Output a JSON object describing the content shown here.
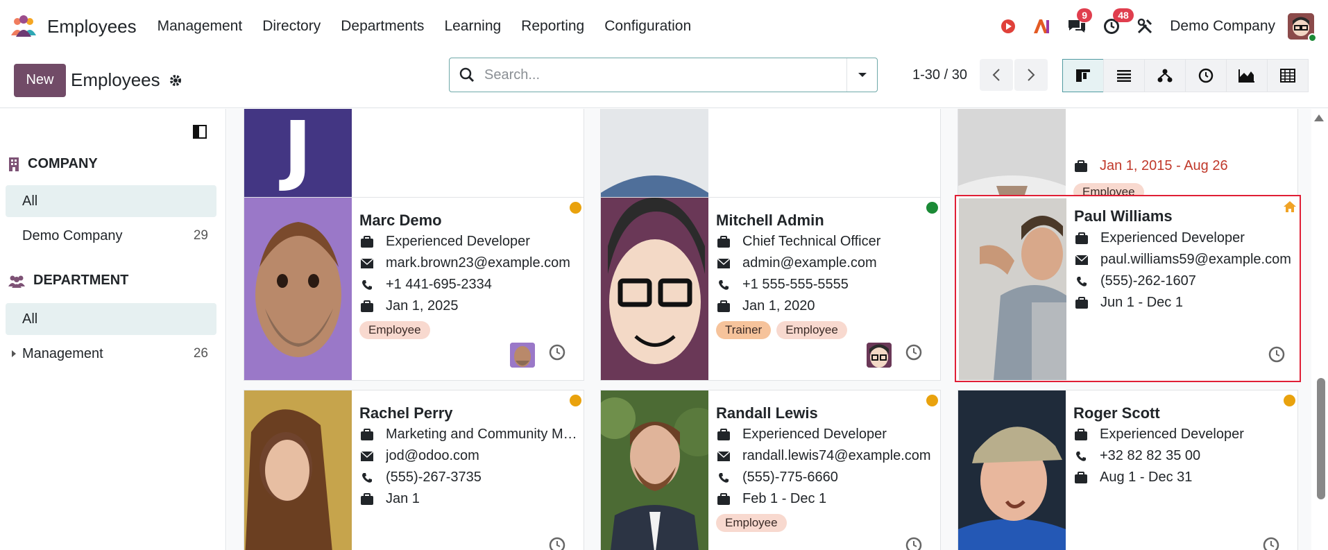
{
  "app": {
    "title": "Employees"
  },
  "menu": [
    "Management",
    "Directory",
    "Departments",
    "Learning",
    "Reporting",
    "Configuration"
  ],
  "systray": {
    "messages_count": "9",
    "activities_count": "48",
    "company": "Demo Company"
  },
  "control": {
    "new_label": "New",
    "breadcrumb": "Employees",
    "search_placeholder": "Search...",
    "pager": "1-30 / 30"
  },
  "sidebar": {
    "company_heading": "COMPANY",
    "company_items": [
      {
        "label": "All",
        "count": ""
      },
      {
        "label": "Demo Company",
        "count": "29"
      }
    ],
    "department_heading": "DEPARTMENT",
    "department_items": [
      {
        "label": "All",
        "count": ""
      },
      {
        "label": "Management",
        "count": "26"
      }
    ]
  },
  "cards": [
    {
      "name": "",
      "date": "",
      "tag": "",
      "mini": "J"
    },
    {
      "name": "",
      "date": "",
      "tag": ""
    },
    {
      "name": "",
      "date": "Jan 1, 2015 - Aug 26",
      "tag": "Employee"
    },
    {
      "name": "Marc Demo",
      "job": "Experienced Developer",
      "email": "mark.brown23@example.com",
      "phone": "+1 441-695-2334",
      "date": "Jan 1, 2025",
      "tags": [
        "Employee"
      ]
    },
    {
      "name": "Mitchell Admin",
      "job": "Chief Technical Officer",
      "email": "admin@example.com",
      "phone": "+1 555-555-5555",
      "date": "Jan 1, 2020",
      "tags": [
        "Trainer",
        "Employee"
      ]
    },
    {
      "name": "Paul Williams",
      "job": "Experienced Developer",
      "email": "paul.williams59@example.com",
      "phone": "(555)-262-1607",
      "date": "Jun 1 - Dec 1",
      "tags": []
    },
    {
      "name": "Rachel Perry",
      "job": "Marketing and Community Manager",
      "email": "jod@odoo.com",
      "phone": "(555)-267-3735",
      "date": "Jan 1",
      "tags": []
    },
    {
      "name": "Randall Lewis",
      "job": "Experienced Developer",
      "email": "randall.lewis74@example.com",
      "phone": "(555)-775-6660",
      "date": "Feb 1 - Dec 1",
      "tags": [
        "Employee"
      ]
    },
    {
      "name": "Roger Scott",
      "job": "Experienced Developer",
      "email": "",
      "phone": "+32 82 82 35 00",
      "date": "Aug 1 - Dec 31",
      "tags": []
    }
  ],
  "colors": {
    "brand": "#714b67",
    "accent": "#017e84",
    "present": "#1b8a36",
    "away": "#e9a20d",
    "selected_border": "#e01e35"
  }
}
